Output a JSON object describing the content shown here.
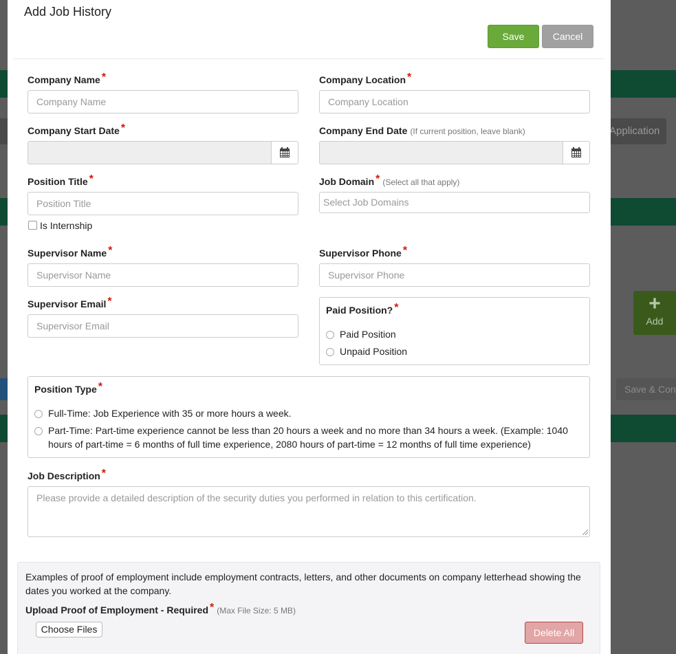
{
  "background": {
    "app_button_label": "Application",
    "add_button_label": "Add",
    "save_button_label": "Save & Con"
  },
  "modal": {
    "title": "Add Job History",
    "save_label": "Save",
    "cancel_label": "Cancel"
  },
  "fields": {
    "company_name": {
      "label": "Company Name",
      "placeholder": "Company Name"
    },
    "company_location": {
      "label": "Company Location",
      "placeholder": "Company Location"
    },
    "company_start_date": {
      "label": "Company Start Date"
    },
    "company_end_date": {
      "label": "Company End Date",
      "hint": "(If current position, leave blank)"
    },
    "position_title": {
      "label": "Position Title",
      "placeholder": "Position Title"
    },
    "is_internship": {
      "label": "Is Internship"
    },
    "job_domain": {
      "label": "Job Domain",
      "hint": "(Select all that apply)",
      "placeholder": "Select Job Domains"
    },
    "supervisor_name": {
      "label": "Supervisor Name",
      "placeholder": "Supervisor Name"
    },
    "supervisor_phone": {
      "label": "Supervisor Phone",
      "placeholder": "Supervisor Phone"
    },
    "supervisor_email": {
      "label": "Supervisor Email",
      "placeholder": "Supervisor Email"
    },
    "paid_position": {
      "label": "Paid Position?",
      "options": [
        "Paid Position",
        "Unpaid Position"
      ]
    },
    "position_type": {
      "label": "Position Type",
      "options": [
        "Full-Time: Job Experience with 35 or more hours a week.",
        "Part-Time: Part-time experience cannot be less than 20 hours a week and no more than 34 hours a week. (Example: 1040 hours of part-time = 6 months of full time experience, 2080 hours of part-time = 12 months of full time experience)"
      ]
    },
    "job_description": {
      "label": "Job Description",
      "placeholder": "Please provide a detailed description of the security duties you performed in relation to this certification."
    }
  },
  "upload": {
    "info": "Examples of proof of employment include employment contracts, letters, and other documents on company letterhead showing the dates you worked at the company.",
    "label": "Upload Proof of Employment - Required",
    "hint": "(Max File Size: 5 MB)",
    "choose_label": "Choose Files",
    "delete_all_label": "Delete All"
  },
  "required_mark": "*",
  "colors": {
    "primary_green": "#6aaa3a",
    "cancel_gray": "#a0a0a0",
    "required_red": "#d01a0a",
    "header_band": "#0f4a33"
  }
}
